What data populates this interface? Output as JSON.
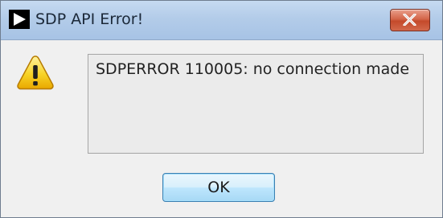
{
  "window": {
    "title": "SDP API Error!",
    "title_icon": "app-play-icon",
    "close_icon": "close-x-icon"
  },
  "message": {
    "icon": "warning-icon",
    "text": "SDPERROR 110005: no connection made"
  },
  "buttons": {
    "ok_label": "OK"
  },
  "colors": {
    "titlebar": "#b3cce9",
    "close_button": "#d46549",
    "dialog_background": "#f0f0f0",
    "ok_button_border": "#3c7fb1",
    "warning_yellow": "#f2c200"
  }
}
